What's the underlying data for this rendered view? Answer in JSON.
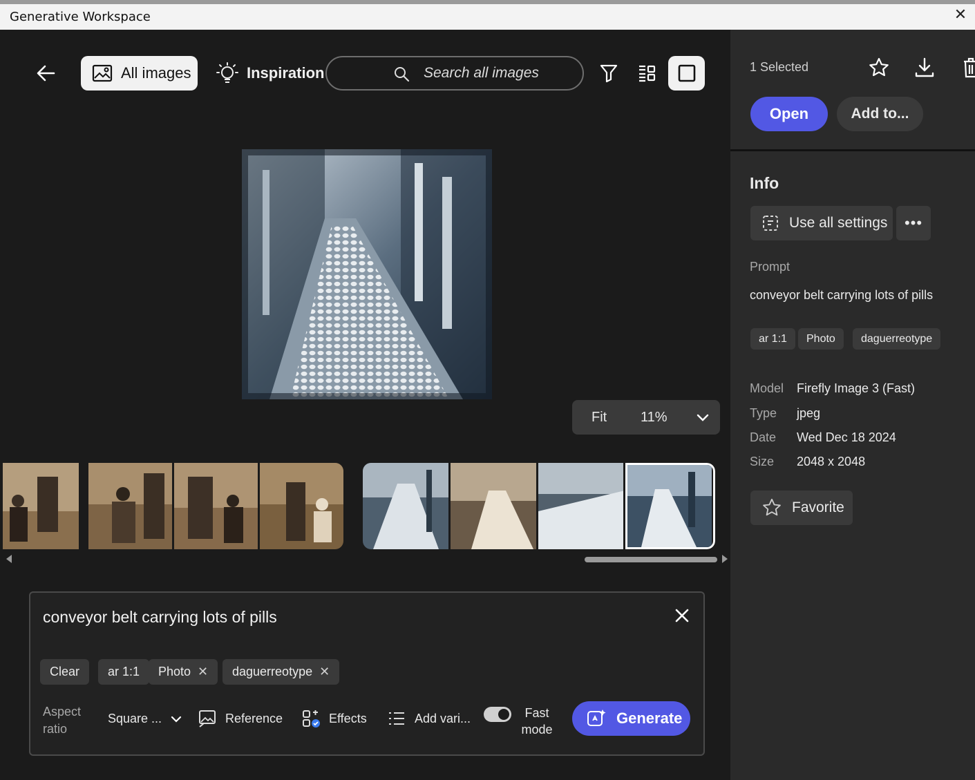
{
  "window": {
    "title": "Generative Workspace",
    "close_glyph": "✕"
  },
  "toolbar": {
    "all_images_label": "All images",
    "inspiration_label": "Inspiration",
    "search_placeholder": "Search all images"
  },
  "viewer": {
    "fit_label": "Fit",
    "zoom_value": "11%"
  },
  "thumbnails": {
    "strip1": [
      "sepia-portrait-1",
      "sepia-portrait-2",
      "sepia-portrait-3",
      "sepia-portrait-4"
    ],
    "strip2": [
      "conveyor-1",
      "conveyor-2",
      "conveyor-3",
      "conveyor-4"
    ],
    "selected_index": 3
  },
  "prompt_bar": {
    "text": "conveyor belt carrying lots of pills",
    "chips": [
      "Clear",
      "ar 1:1",
      "Photo",
      "daguerreotype"
    ],
    "aspect_label_1": "Aspect",
    "aspect_label_2": "ratio",
    "aspect_value": "Square ...",
    "reference_label": "Reference",
    "effects_label": "Effects",
    "add_variations_label": "Add vari...",
    "fast_mode_1": "Fast",
    "fast_mode_2": "mode",
    "fast_mode_on": true,
    "generate_label": "Generate"
  },
  "panel": {
    "selected_text": "1 Selected",
    "open_label": "Open",
    "add_to_label": "Add to...",
    "info_heading": "Info",
    "use_all_settings_label": "Use all settings",
    "more_label": "•••",
    "prompt_label": "Prompt",
    "prompt_value": "conveyor belt carrying lots of pills",
    "tags": [
      "ar 1:1",
      "Photo",
      "daguerreotype"
    ],
    "meta": [
      {
        "label": "Model",
        "value": "Firefly Image 3 (Fast)"
      },
      {
        "label": "Type",
        "value": "jpeg"
      },
      {
        "label": "Date",
        "value": "Wed Dec 18 2024"
      },
      {
        "label": "Size",
        "value": "2048 x 2048"
      }
    ],
    "favorite_label": "Favorite"
  },
  "colors": {
    "accent": "#5258e4",
    "bg": "#1b1b1b",
    "panel_bg": "#2a2a2a",
    "chip_bg": "#3a3a3a"
  }
}
